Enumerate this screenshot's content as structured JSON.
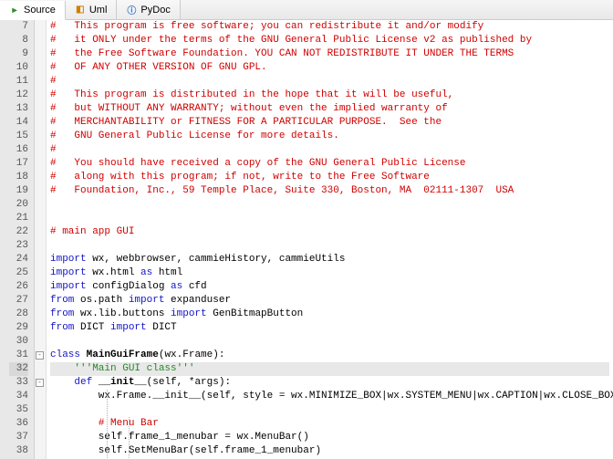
{
  "tabs": [
    {
      "label": "Source",
      "icon": "source-icon",
      "active": true
    },
    {
      "label": "Uml",
      "icon": "uml-icon",
      "active": false
    },
    {
      "label": "PyDoc",
      "icon": "pydoc-icon",
      "active": false
    }
  ],
  "gutter_start": 7,
  "gutter_end": 38,
  "highlighted_line": 32,
  "fold_markers": [
    {
      "line": 31,
      "symbol": "-"
    },
    {
      "line": 33,
      "symbol": "-"
    }
  ],
  "indent_guides": [
    {
      "col": 66,
      "from_line": 34,
      "to_line": 38
    },
    {
      "col": 90,
      "from_line": 36,
      "to_line": 38
    }
  ],
  "code": {
    "l7": [
      {
        "t": "comment",
        "v": "#   This program is free software; you can redistribute it and/or modify"
      }
    ],
    "l8": [
      {
        "t": "comment",
        "v": "#   it ONLY under the terms of the GNU General Public License v2 as published by"
      }
    ],
    "l9": [
      {
        "t": "comment",
        "v": "#   the Free Software Foundation. YOU CAN NOT REDISTRIBUTE IT UNDER THE TERMS"
      }
    ],
    "l10": [
      {
        "t": "comment",
        "v": "#   OF ANY OTHER VERSION OF GNU GPL."
      }
    ],
    "l11": [
      {
        "t": "comment",
        "v": "#"
      }
    ],
    "l12": [
      {
        "t": "comment",
        "v": "#   This program is distributed in the hope that it will be useful,"
      }
    ],
    "l13": [
      {
        "t": "comment",
        "v": "#   but WITHOUT ANY WARRANTY; without even the implied warranty of"
      }
    ],
    "l14": [
      {
        "t": "comment",
        "v": "#   MERCHANTABILITY or FITNESS FOR A PARTICULAR PURPOSE.  See the"
      }
    ],
    "l15": [
      {
        "t": "comment",
        "v": "#   GNU General Public License for more details."
      }
    ],
    "l16": [
      {
        "t": "comment",
        "v": "#"
      }
    ],
    "l17": [
      {
        "t": "comment",
        "v": "#   You should have received a copy of the GNU General Public License"
      }
    ],
    "l18": [
      {
        "t": "comment",
        "v": "#   along with this program; if not, write to the Free Software"
      }
    ],
    "l19": [
      {
        "t": "comment",
        "v": "#   Foundation, Inc., 59 Temple Place, Suite 330, Boston, MA  02111-1307  USA"
      }
    ],
    "l20": [],
    "l21": [],
    "l22": [
      {
        "t": "comment",
        "v": "# main app GUI"
      }
    ],
    "l23": [],
    "l24": [
      {
        "t": "kw",
        "v": "import"
      },
      {
        "t": "",
        "v": " wx, webbrowser, cammieHistory, cammieUtils"
      }
    ],
    "l25": [
      {
        "t": "kw",
        "v": "import"
      },
      {
        "t": "",
        "v": " wx.html "
      },
      {
        "t": "kw",
        "v": "as"
      },
      {
        "t": "",
        "v": " html"
      }
    ],
    "l26": [
      {
        "t": "kw",
        "v": "import"
      },
      {
        "t": "",
        "v": " configDialog "
      },
      {
        "t": "kw",
        "v": "as"
      },
      {
        "t": "",
        "v": " cfd"
      }
    ],
    "l27": [
      {
        "t": "kw",
        "v": "from"
      },
      {
        "t": "",
        "v": " os.path "
      },
      {
        "t": "kw",
        "v": "import"
      },
      {
        "t": "",
        "v": " expanduser"
      }
    ],
    "l28": [
      {
        "t": "kw",
        "v": "from"
      },
      {
        "t": "",
        "v": " wx.lib.buttons "
      },
      {
        "t": "kw",
        "v": "import"
      },
      {
        "t": "",
        "v": " GenBitmapButton"
      }
    ],
    "l29": [
      {
        "t": "kw",
        "v": "from"
      },
      {
        "t": "",
        "v": " DICT "
      },
      {
        "t": "kw",
        "v": "import"
      },
      {
        "t": "",
        "v": " DICT"
      }
    ],
    "l30": [],
    "l31": [
      {
        "t": "kw",
        "v": "class"
      },
      {
        "t": "",
        "v": " "
      },
      {
        "t": "def",
        "v": "MainGuiFrame"
      },
      {
        "t": "",
        "v": "(wx.Frame):"
      }
    ],
    "l32": [
      {
        "t": "",
        "v": "    "
      },
      {
        "t": "str",
        "v": "'''Main GUI class'''"
      }
    ],
    "l33": [
      {
        "t": "",
        "v": "    "
      },
      {
        "t": "kw",
        "v": "def"
      },
      {
        "t": "",
        "v": " "
      },
      {
        "t": "def",
        "v": "__init__"
      },
      {
        "t": "",
        "v": "(self, *args):"
      }
    ],
    "l34": [
      {
        "t": "",
        "v": "        wx.Frame.__init__(self, style = wx.MINIMIZE_BOX|wx.SYSTEM_MENU|wx.CAPTION|wx.CLOSE_BOX, *args)"
      }
    ],
    "l35": [],
    "l36": [
      {
        "t": "",
        "v": "        "
      },
      {
        "t": "comment",
        "v": "# Menu Bar"
      }
    ],
    "l37": [
      {
        "t": "",
        "v": "        self.frame_1_menubar = wx.MenuBar()"
      }
    ],
    "l38": [
      {
        "t": "",
        "v": "        self.SetMenuBar(self.frame_1_menubar)"
      }
    ]
  }
}
